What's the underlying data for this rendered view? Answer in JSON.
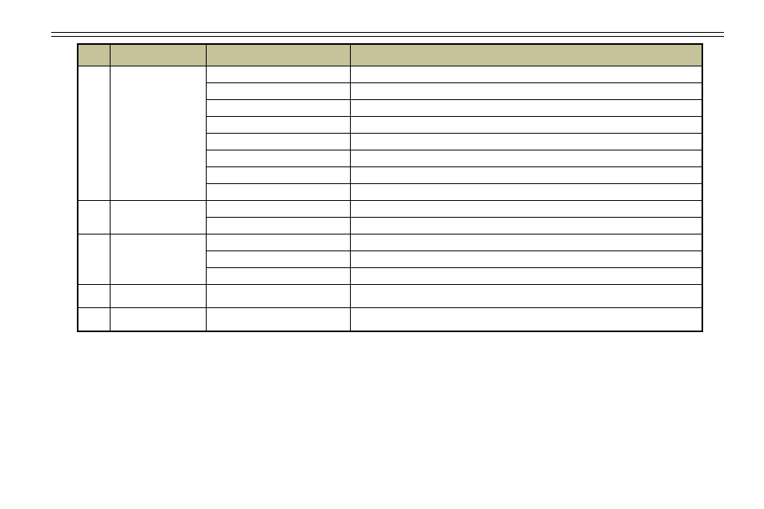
{
  "table": {
    "headers": [
      "",
      "",
      "",
      ""
    ],
    "rows": [
      {
        "c1": "",
        "c2": "",
        "c3": "",
        "c4": ""
      },
      {
        "c3": "",
        "c4": ""
      },
      {
        "c3": "",
        "c4": ""
      },
      {
        "c3": "",
        "c4": ""
      },
      {
        "c3": "",
        "c4": ""
      },
      {
        "c3": "",
        "c4": ""
      },
      {
        "c3": "",
        "c4": ""
      },
      {
        "c3": "",
        "c4": ""
      },
      {
        "c1": "",
        "c2": "",
        "c3": "",
        "c4": ""
      },
      {
        "c3": "",
        "c4": ""
      },
      {
        "c1": "",
        "c2": "",
        "c3": "",
        "c4": ""
      },
      {
        "c3": "",
        "c4": ""
      },
      {
        "c3": "",
        "c4": ""
      },
      {
        "c1": "",
        "c2": "",
        "c3": "",
        "c4": ""
      },
      {
        "c1": "",
        "c2": "",
        "c3": "",
        "c4": ""
      }
    ]
  }
}
